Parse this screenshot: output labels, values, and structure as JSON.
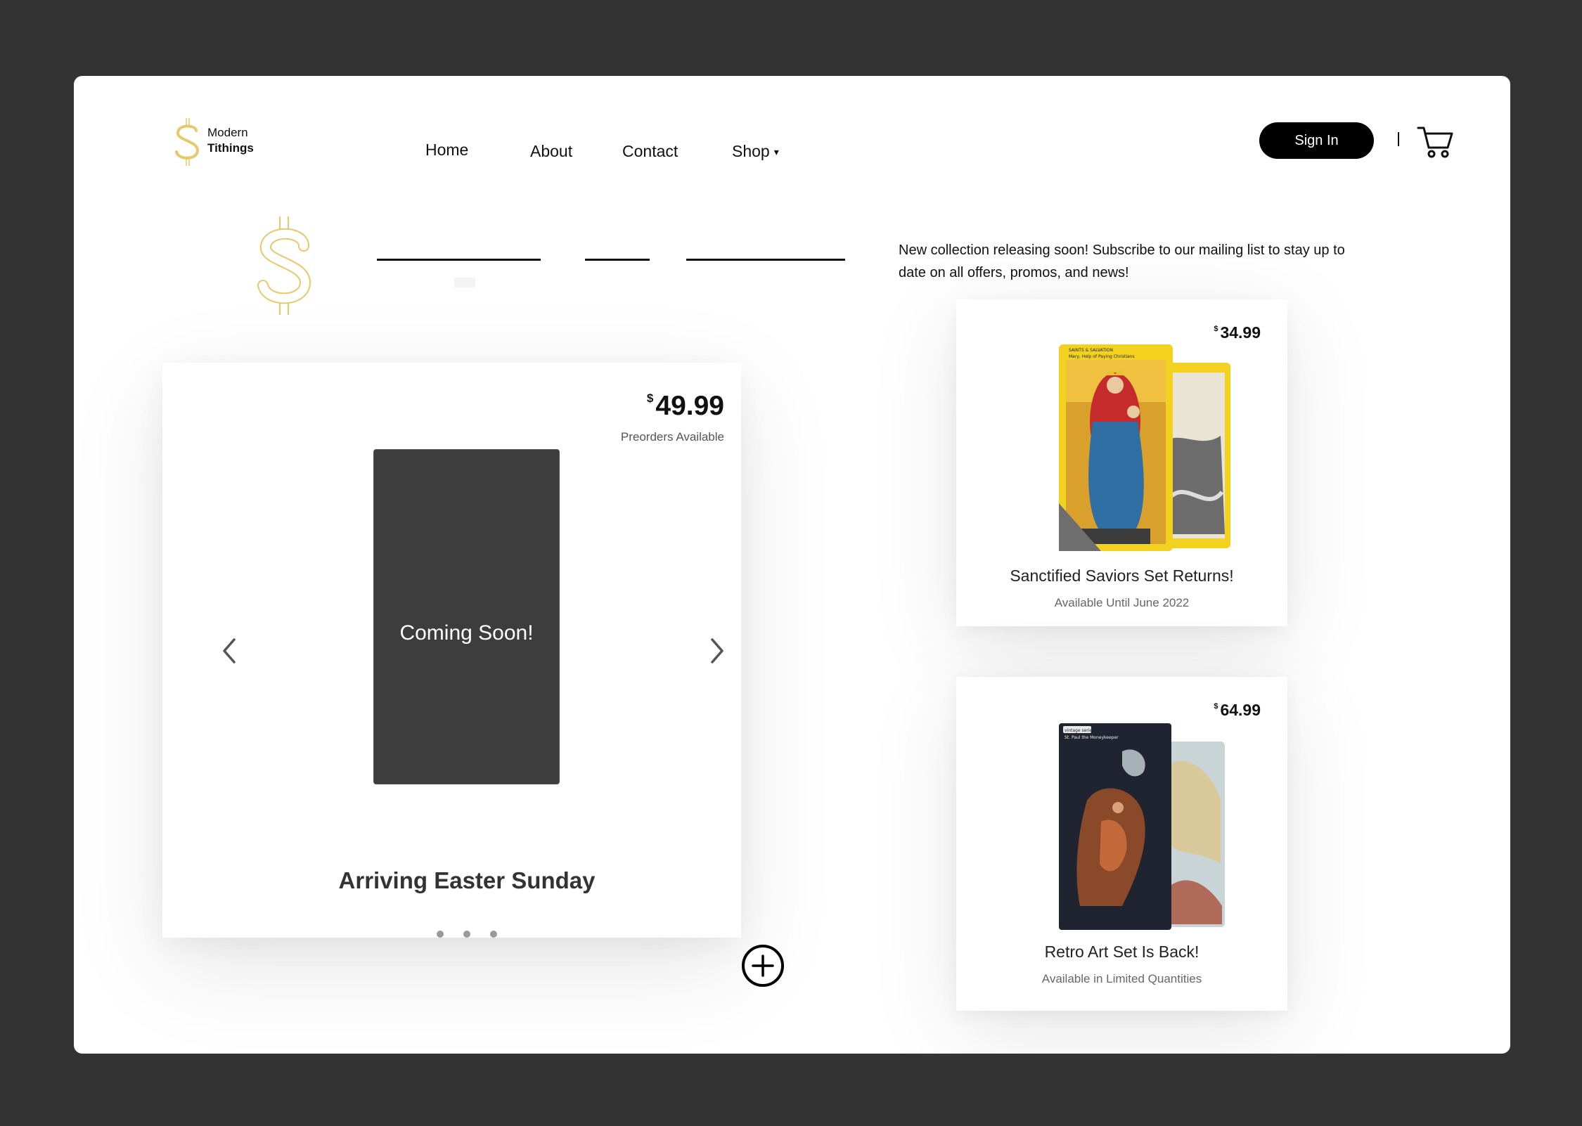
{
  "brand": {
    "line1": "Modern",
    "line2": "Tithings"
  },
  "nav": {
    "home": "Home",
    "about": "About",
    "contact": "Contact",
    "shop": "Shop",
    "shop_caret": "▾"
  },
  "header": {
    "signin_label": "Sign In",
    "cart_icon": "cart-icon"
  },
  "announcement": "New collection releasing soon! Subscribe to our mailing list to stay up to date on all offers, promos, and news!",
  "featured": {
    "currency": "$",
    "price": "49.99",
    "note": "Preorders Available",
    "image_text": "Coming Soon!",
    "title": "Arriving Easter Sunday",
    "carousel_dots": 3,
    "active_dot": 1
  },
  "products": [
    {
      "currency": "$",
      "price": "34.99",
      "title": "Sanctified Saviors Set Returns!",
      "subtitle": "Available Until June 2022",
      "card_label_top": "SAINTS & SALVATION",
      "card_label_name": "Mary, Help of Paying Christians"
    },
    {
      "currency": "$",
      "price": "64.99",
      "title": "Retro Art Set Is Back!",
      "subtitle": "Available in Limited Quantities",
      "card_label_top": "vintage series",
      "card_label_name": "St. Paul the Moneykeeper"
    }
  ],
  "colors": {
    "background": "#333333",
    "frame": "#ffffff",
    "accent_gold": "#e8c96a",
    "card_yellow": "#f2d21e",
    "button": "#000000"
  }
}
